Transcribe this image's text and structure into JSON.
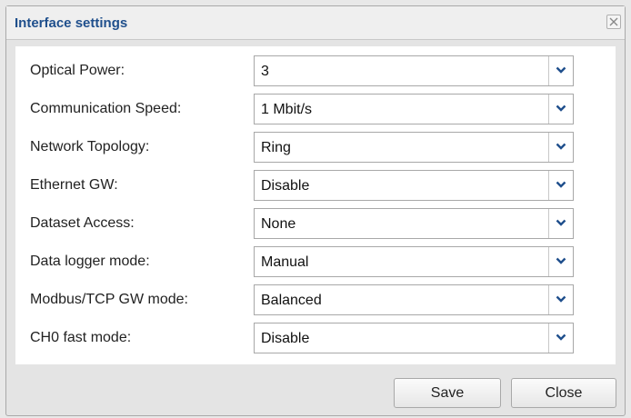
{
  "dialog": {
    "title": "Interface settings",
    "close_icon": "close-icon",
    "save_label": "Save",
    "close_label": "Close"
  },
  "fields": [
    {
      "label": "Optical Power:",
      "value": "3"
    },
    {
      "label": "Communication Speed:",
      "value": "1 Mbit/s"
    },
    {
      "label": "Network Topology:",
      "value": "Ring"
    },
    {
      "label": "Ethernet GW:",
      "value": "Disable"
    },
    {
      "label": "Dataset Access:",
      "value": "None"
    },
    {
      "label": "Data logger mode:",
      "value": "Manual"
    },
    {
      "label": "Modbus/TCP GW mode:",
      "value": "Balanced"
    },
    {
      "label": "CH0 fast mode:",
      "value": "Disable"
    }
  ],
  "colors": {
    "title": "#1f4f8c",
    "dropdown_arrow": "#1f4f8c"
  }
}
